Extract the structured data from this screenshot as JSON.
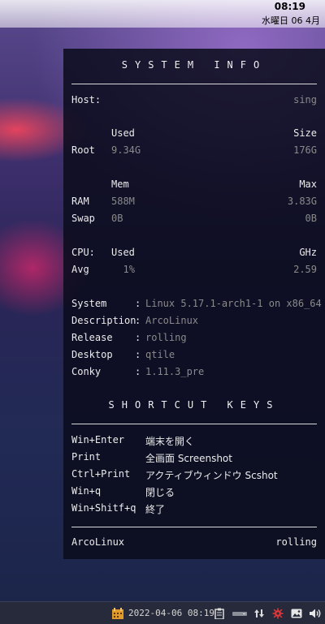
{
  "topbar": {
    "time": "08:19",
    "date": "水曜日 06 4月"
  },
  "conky": {
    "system_info_header": "SYSTEM INFO",
    "host": {
      "label": "Host:",
      "value": "sing"
    },
    "disk": {
      "used_header": "Used",
      "size_header": "Size",
      "root_label": "Root",
      "root_used": "9.34G",
      "root_size": "176G"
    },
    "memory": {
      "mem_header": "Mem",
      "max_header": "Max",
      "ram_label": "RAM",
      "ram_used": "588M",
      "ram_max": "3.83G",
      "swap_label": "Swap",
      "swap_used": "0B",
      "swap_max": "0B"
    },
    "cpu": {
      "cpu_label": "CPU:",
      "used_header": "Used",
      "ghz_header": "GHz",
      "avg_label": "Avg",
      "avg_used": "1%",
      "avg_ghz": "2.59"
    },
    "details": [
      {
        "label": "System",
        "value": "Linux 5.17.1-arch1-1 on x86_64"
      },
      {
        "label": "Description",
        "value": "ArcoLinux"
      },
      {
        "label": "Release",
        "value": "rolling"
      },
      {
        "label": "Desktop",
        "value": "qtile"
      },
      {
        "label": "Conky",
        "value": "1.11.3_pre"
      }
    ],
    "separator": ":",
    "shortcut_header": "SHORTCUT KEYS",
    "shortcuts": [
      {
        "key": "Win+Enter",
        "desc": "端末を開く"
      },
      {
        "key": "Print",
        "desc": "全画面 Screenshot"
      },
      {
        "key": "Ctrl+Print",
        "desc": "アクティブウィンドウ Scshot"
      },
      {
        "key": "Win+q",
        "desc": "閉じる"
      },
      {
        "key": "Win+Shitf+q",
        "desc": "終了"
      }
    ],
    "footer": {
      "distro": "ArcoLinux",
      "release": "rolling"
    }
  },
  "taskbar": {
    "datetime": "2022-04-06 08:19",
    "icons": [
      "calendar-icon",
      "clipboard-icon",
      "drive-icon",
      "network-arrows-icon",
      "bug-settings-icon",
      "image-viewer-icon",
      "volume-icon"
    ],
    "accent_orange": "#e09a2a",
    "accent_red": "#e03838"
  }
}
